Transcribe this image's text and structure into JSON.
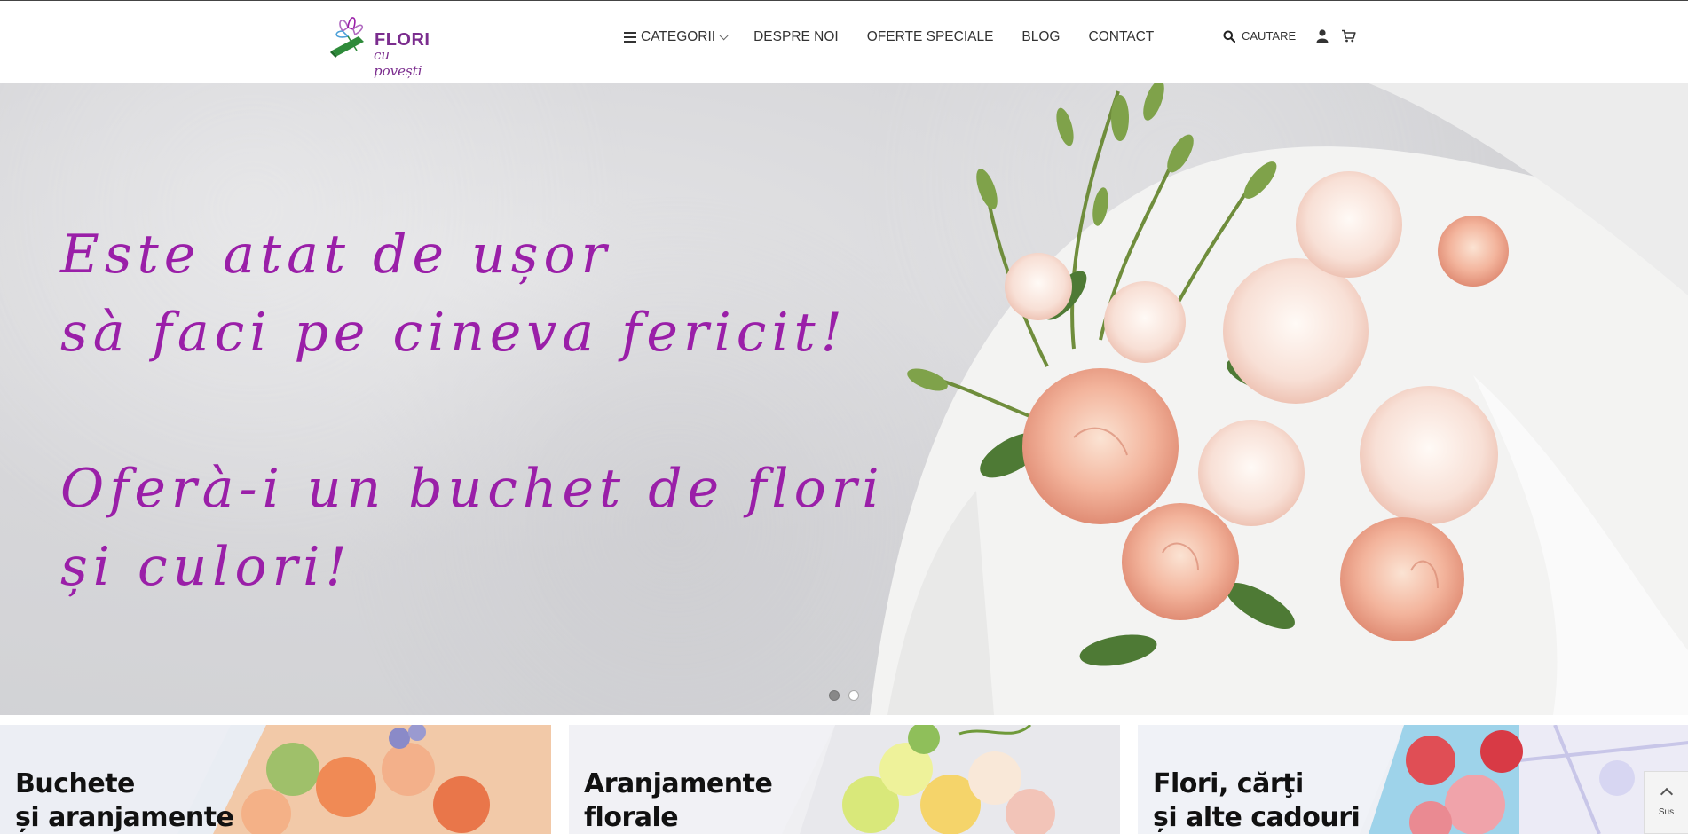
{
  "logo": {
    "title": "FLORI",
    "subtitle": "cu povești"
  },
  "nav": {
    "items": [
      {
        "label": "CATEGORII"
      },
      {
        "label": "DESPRE NOI"
      },
      {
        "label": "OFERTE SPECIALE"
      },
      {
        "label": "BLOG"
      },
      {
        "label": "CONTACT"
      }
    ]
  },
  "tools": {
    "search_label": "CAUTARE",
    "icons": [
      "search-icon",
      "user-icon",
      "cart-icon"
    ]
  },
  "hero": {
    "lines": [
      "Este atat de ușor",
      "sà faci pe cineva fericit!",
      "Oferà-i un buchet de flori",
      "și culori!"
    ],
    "slides": 2,
    "active_slide": 1
  },
  "cards": [
    {
      "line1": "Buchete",
      "line2": "și aranjamente"
    },
    {
      "line1": "Aranjamente",
      "line2": "florale"
    },
    {
      "line1": "Flori, cărţi",
      "line2": "și alte cadouri"
    }
  ],
  "back_to_top": {
    "label": "Sus"
  },
  "colors": {
    "accent": "#9a1fa8",
    "brand": "#7b2d8e",
    "logo_green": "#2e8b3a"
  }
}
